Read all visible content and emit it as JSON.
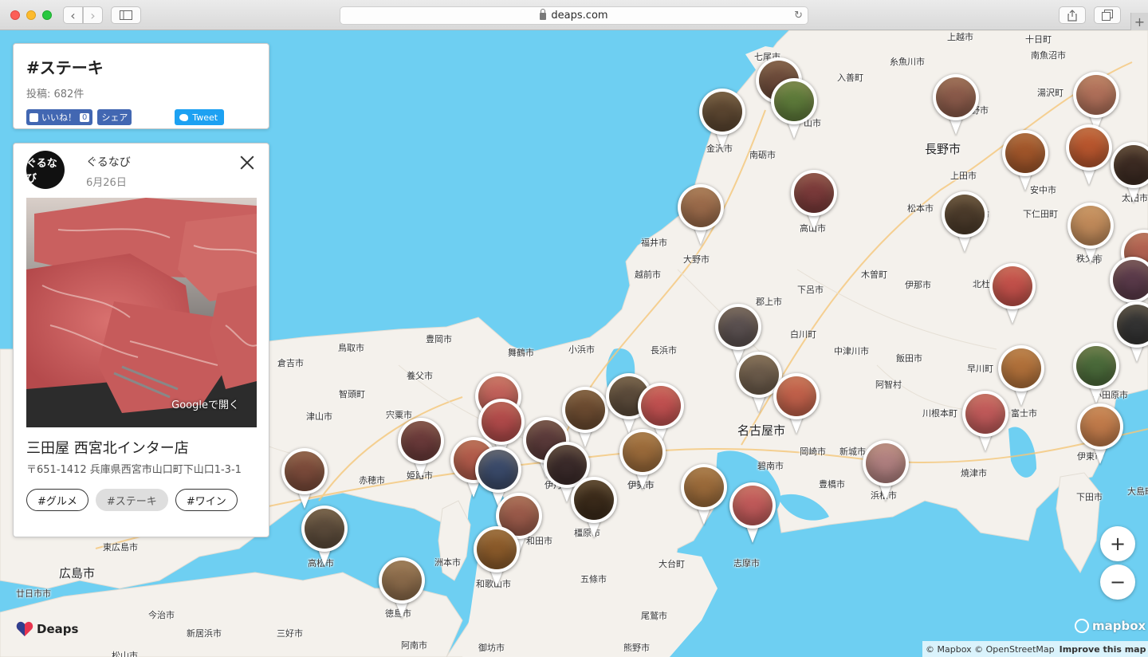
{
  "browser": {
    "url": "deaps.com"
  },
  "tag_panel": {
    "title": "#ステーキ",
    "post_count": "投稿: 682件",
    "like_label": "いいね！",
    "like_count": "0",
    "share_label": "シェア",
    "tweet_label": "Tweet"
  },
  "post": {
    "avatar_text": "ぐるなび",
    "author": "ぐるなび",
    "date": "6月26日",
    "google_link": "Googleで開く",
    "shop_name": "三田屋 西宮北インター店",
    "address": "〒651-1412 兵庫県西宮市山口町下山口1-3-1",
    "tags": [
      "#グルメ",
      "#ステーキ",
      "#ワイン"
    ],
    "active_tag_index": 1
  },
  "map": {
    "places": [
      {
        "name": "上越市",
        "big": false
      },
      {
        "name": "十日町",
        "big": false
      },
      {
        "name": "七尾市",
        "big": false
      },
      {
        "name": "糸魚川市",
        "big": false
      },
      {
        "name": "南魚沼市",
        "big": false
      },
      {
        "name": "入善町",
        "big": false
      },
      {
        "name": "湯沢町",
        "big": false
      },
      {
        "name": "山市",
        "big": false
      },
      {
        "name": "野市",
        "big": false
      },
      {
        "name": "金沢市",
        "big": false
      },
      {
        "name": "南砺市",
        "big": false
      },
      {
        "name": "長野市",
        "big": true
      },
      {
        "name": "上田市",
        "big": false
      },
      {
        "name": "安中市",
        "big": false
      },
      {
        "name": "太田市",
        "big": false
      },
      {
        "name": "高山市",
        "big": false
      },
      {
        "name": "松本市",
        "big": false
      },
      {
        "name": "佐久市",
        "big": false
      },
      {
        "name": "下仁田町",
        "big": false
      },
      {
        "name": "福井市",
        "big": false
      },
      {
        "name": "大野市",
        "big": false
      },
      {
        "name": "秩父市",
        "big": false
      },
      {
        "name": "越前市",
        "big": false
      },
      {
        "name": "木曽町",
        "big": false
      },
      {
        "name": "下呂市",
        "big": false
      },
      {
        "name": "伊那市",
        "big": false
      },
      {
        "name": "北杜市",
        "big": false
      },
      {
        "name": "郡上市",
        "big": false
      },
      {
        "name": "白川町",
        "big": false
      },
      {
        "name": "豊岡市",
        "big": false
      },
      {
        "name": "鳥取市",
        "big": false
      },
      {
        "name": "舞鶴市",
        "big": false
      },
      {
        "name": "小浜市",
        "big": false
      },
      {
        "name": "長浜市",
        "big": false
      },
      {
        "name": "中津川市",
        "big": false
      },
      {
        "name": "飯田市",
        "big": false
      },
      {
        "name": "倉吉市",
        "big": false
      },
      {
        "name": "養父市",
        "big": false
      },
      {
        "name": "早川町",
        "big": false
      },
      {
        "name": "智頭町",
        "big": false
      },
      {
        "name": "阿智村",
        "big": false
      },
      {
        "name": "津山市",
        "big": false
      },
      {
        "name": "宍粟市",
        "big": false
      },
      {
        "name": "川根本町",
        "big": false
      },
      {
        "name": "富士市",
        "big": false
      },
      {
        "name": "名古屋市",
        "big": true
      },
      {
        "name": "岡崎市",
        "big": false
      },
      {
        "name": "新城市",
        "big": false
      },
      {
        "name": "赤穂市",
        "big": false
      },
      {
        "name": "姫路市",
        "big": false
      },
      {
        "name": "伊賀市",
        "big": false
      },
      {
        "name": "碧南市",
        "big": false
      },
      {
        "name": "焼津市",
        "big": false
      },
      {
        "name": "伊東市",
        "big": false
      },
      {
        "name": "豊橋市",
        "big": false
      },
      {
        "name": "浜松市",
        "big": false
      },
      {
        "name": "下田市",
        "big": false
      },
      {
        "name": "大島町",
        "big": false
      },
      {
        "name": "橿原市",
        "big": false
      },
      {
        "name": "和田市",
        "big": false
      },
      {
        "name": "東広島市",
        "big": false
      },
      {
        "name": "広島市",
        "big": true
      },
      {
        "name": "高松市",
        "big": false
      },
      {
        "name": "洲本市",
        "big": false
      },
      {
        "name": "大台町",
        "big": false
      },
      {
        "name": "志摩市",
        "big": false
      },
      {
        "name": "廿日市市",
        "big": false
      },
      {
        "name": "和歌山市",
        "big": false
      },
      {
        "name": "五條市",
        "big": false
      },
      {
        "name": "今治市",
        "big": false
      },
      {
        "name": "徳島市",
        "big": false
      },
      {
        "name": "尾鷲市",
        "big": false
      },
      {
        "name": "新居浜市",
        "big": false
      },
      {
        "name": "三好市",
        "big": false
      },
      {
        "name": "阿南市",
        "big": false
      },
      {
        "name": "御坊市",
        "big": false
      },
      {
        "name": "熊野市",
        "big": false
      },
      {
        "name": "松山市",
        "big": false
      },
      {
        "name": "伊勢市",
        "big": false
      },
      {
        "name": "伊丹市",
        "big": false
      },
      {
        "name": "小田原市",
        "big": false
      },
      {
        "name": "八",
        "big": false
      },
      {
        "name": "市",
        "big": false
      }
    ],
    "zoom_in_label": "+",
    "zoom_out_label": "−",
    "brand": "Deaps",
    "mapbox_label": "mapbox",
    "attribution": "© Mapbox © OpenStreetMap",
    "improve_label": "Improve this map"
  },
  "colors": {
    "water": "#6ecff2",
    "land": "#f4f1ec",
    "fb": "#4267b2",
    "twitter": "#1da1f2"
  }
}
